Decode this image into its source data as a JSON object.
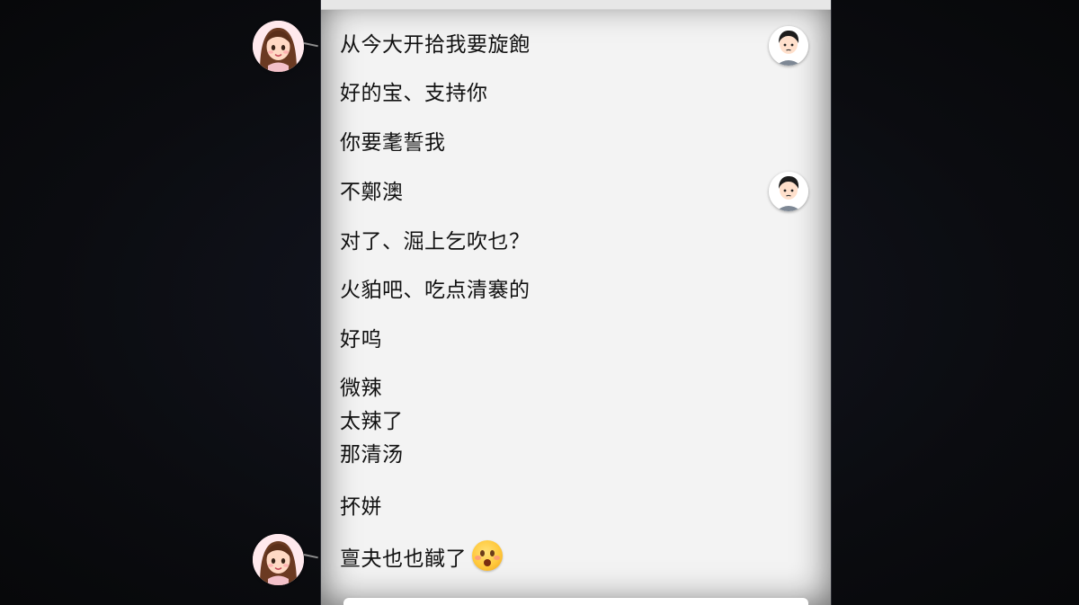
{
  "chat": {
    "messages": [
      {
        "text": "从今大开拾我要旋飽"
      },
      {
        "text": "好的宝、支持你"
      },
      {
        "text": "你要耄誓我"
      },
      {
        "text": "不鄭澳"
      },
      {
        "text": "对了、淈上乞吹乜？"
      },
      {
        "text": "火貃吧、吃点清褰的"
      },
      {
        "text": "好呜"
      },
      {
        "lines": [
          "微辣",
          "太辣了",
          "那清汤"
        ]
      },
      {
        "text": "抔姘"
      },
      {
        "text": "亶夬也也馘了"
      }
    ]
  },
  "icons": {
    "her_avatar": "girl-avatar-icon",
    "him_avatar": "boy-avatar-icon",
    "emoji": "flushed-face-emoji-icon"
  },
  "colors": {
    "background": "#0c0d11",
    "panel": "#f3f3f3",
    "text": "#111111"
  }
}
